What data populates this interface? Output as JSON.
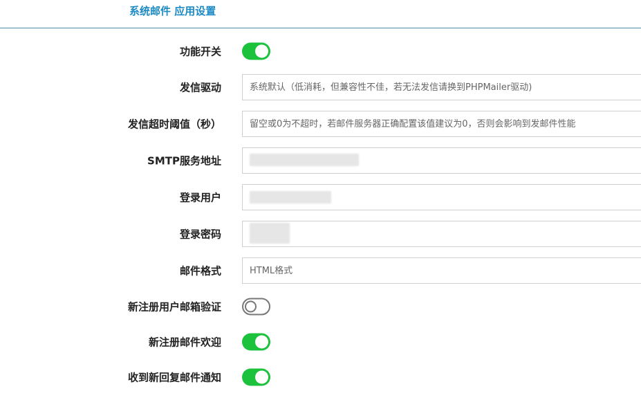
{
  "header": {
    "title": "系统邮件 应用设置"
  },
  "form": {
    "enable": {
      "label": "功能开关",
      "state": "on"
    },
    "driver": {
      "label": "发信驱动",
      "value": "",
      "placeholder": "系统默认（低消耗，但兼容性不佳，若无法发信请换到PHPMailer驱动)"
    },
    "timeout": {
      "label": "发信超时阈值（秒）",
      "value": "",
      "placeholder": "留空或0为不超时，若邮件服务器正确配置该值建议为0，否则会影响到发邮件性能"
    },
    "smtp_host": {
      "label": "SMTP服务地址",
      "value": "",
      "placeholder": ""
    },
    "login_user": {
      "label": "登录用户",
      "value": "",
      "placeholder": ""
    },
    "login_password": {
      "label": "登录密码",
      "value": "",
      "placeholder": ""
    },
    "mail_format": {
      "label": "邮件格式",
      "value": "",
      "placeholder": "HTML格式"
    },
    "new_user_verify": {
      "label": "新注册用户邮箱验证",
      "state": "off"
    },
    "new_user_welcome": {
      "label": "新注册邮件欢迎",
      "state": "on"
    },
    "reply_notify": {
      "label": "收到新回复邮件通知",
      "state": "on"
    }
  },
  "colors": {
    "accent": "#1c8ac4",
    "toggle_on": "#1cc23c",
    "toggle_off_border": "#777777",
    "divider": "#4b8aa4"
  }
}
